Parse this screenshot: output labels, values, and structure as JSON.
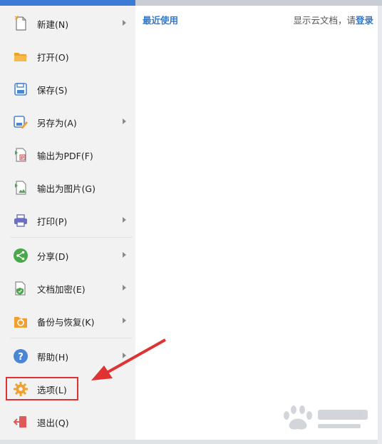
{
  "menu": {
    "items": [
      {
        "label": "新建(N)",
        "icon": "new-document-icon",
        "has_submenu": true
      },
      {
        "label": "打开(O)",
        "icon": "open-folder-icon",
        "has_submenu": false
      },
      {
        "label": "保存(S)",
        "icon": "save-icon",
        "has_submenu": false
      },
      {
        "label": "另存为(A)",
        "icon": "save-as-icon",
        "has_submenu": true
      },
      {
        "label": "输出为PDF(F)",
        "icon": "export-pdf-icon",
        "has_submenu": false
      },
      {
        "label": "输出为图片(G)",
        "icon": "export-image-icon",
        "has_submenu": false
      },
      {
        "label": "打印(P)",
        "icon": "printer-icon",
        "has_submenu": true
      },
      {
        "label": "分享(D)",
        "icon": "share-icon",
        "has_submenu": true
      },
      {
        "label": "文档加密(E)",
        "icon": "encrypt-document-icon",
        "has_submenu": true
      },
      {
        "label": "备份与恢复(K)",
        "icon": "backup-restore-icon",
        "has_submenu": true
      },
      {
        "label": "帮助(H)",
        "icon": "help-icon",
        "has_submenu": true
      },
      {
        "label": "选项(L)",
        "icon": "gear-icon",
        "has_submenu": false
      },
      {
        "label": "退出(Q)",
        "icon": "exit-icon",
        "has_submenu": false
      }
    ]
  },
  "content": {
    "recent_title": "最近使用",
    "cloud_prefix": "显示云文档，请",
    "login_label": "登录"
  },
  "annotation": {
    "highlight_color": "#e03232",
    "arrow_color": "#e03232"
  },
  "colors": {
    "accent_blue": "#2f78d0",
    "menu_bg": "#f2f2f2"
  }
}
